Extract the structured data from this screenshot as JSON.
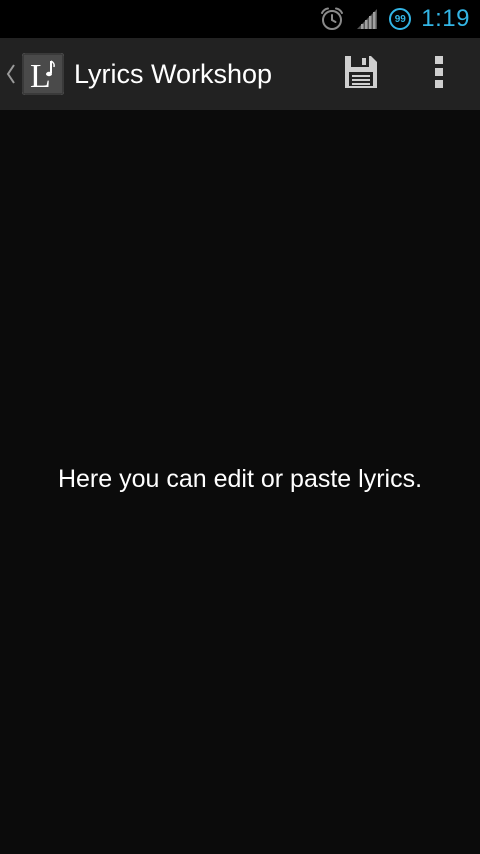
{
  "status_bar": {
    "icons": [
      "alarm-icon",
      "signal-icon",
      "battery-icon"
    ],
    "battery_level": "99",
    "time": "1:19",
    "accent_color": "#33b5e5"
  },
  "action_bar": {
    "app_icon_letter": "L",
    "title": "Lyrics Workshop",
    "actions": [
      {
        "name": "save",
        "icon": "floppy-disk-icon"
      },
      {
        "name": "more",
        "icon": "overflow-menu-icon"
      }
    ]
  },
  "content": {
    "empty_message": "Here you can edit or paste lyrics."
  }
}
